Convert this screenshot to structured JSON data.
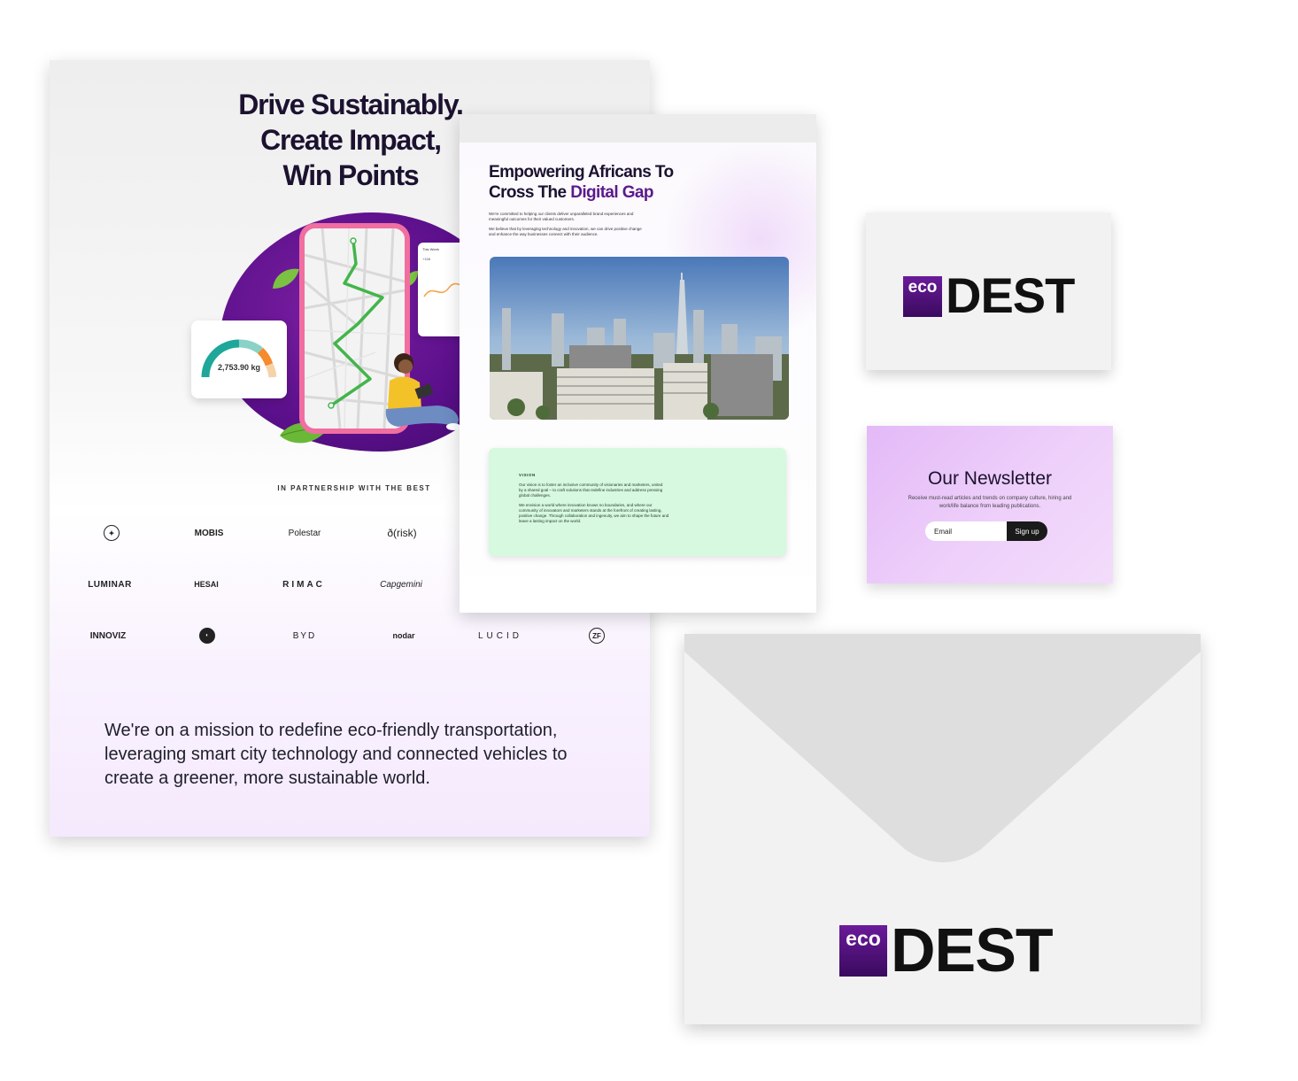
{
  "flyer": {
    "headline": [
      "Drive Sustainably.",
      "Create Impact,",
      "Win Points"
    ],
    "gauge_value": "2,753.90 kg",
    "week_card": {
      "title": "This Week",
      "value": "+158"
    },
    "partnership_label": "IN PARTNERSHIP WITH THE BEST",
    "partner_logos": [
      "MOBIS",
      "Polestar",
      "ð(risk)",
      "LUMINAR",
      "HESAI",
      "RIMAC",
      "Capgemini",
      "INNOVIZ",
      "BYD",
      "nodar",
      "LUCID",
      "ZF"
    ],
    "mission": "We're on a mission to redefine eco-friendly transportation, leveraging smart city technology and connected vehicles to create a greener, more sustainable world."
  },
  "webpage": {
    "title_part1": "Empowering Africans To",
    "title_part2": "Cross The",
    "title_accent": "Digital Gap",
    "body": [
      "We're committed to helping our clients deliver unparalleled brand experiences and meaningful outcomes for their valued customers.",
      "We believe that by leveraging technology and innovation, we can drive positive change and enhance the way businesses connect with their audience."
    ],
    "vision_label": "VISION",
    "vision_paragraphs": [
      "Our vision is to foster an inclusive community of visionaries and marketers, united by a shared goal – to craft solutions that redefine industries and address pressing global challenges.",
      "We envision a world where innovation knows no boundaries, and where our community of innovators and marketers stands at the forefront of creating lasting, positive change. Through collaboration and ingenuity, we aim to shape the future and leave a lasting impact on the world."
    ]
  },
  "brand": {
    "eco": "eco",
    "dest": "DEST"
  },
  "newsletter": {
    "title": "Our Newsletter",
    "subtitle": "Receive must-read articles and trends on company culture, hiring and work/life balance from leading publications.",
    "email_placeholder": "Email",
    "signup_label": "Sign up"
  },
  "colors": {
    "brand_purple": "#5b1a8c",
    "newsletter_bg": "#e9c6f8",
    "vision_bg": "#d6f9df",
    "phone_border": "#f06ea0"
  }
}
